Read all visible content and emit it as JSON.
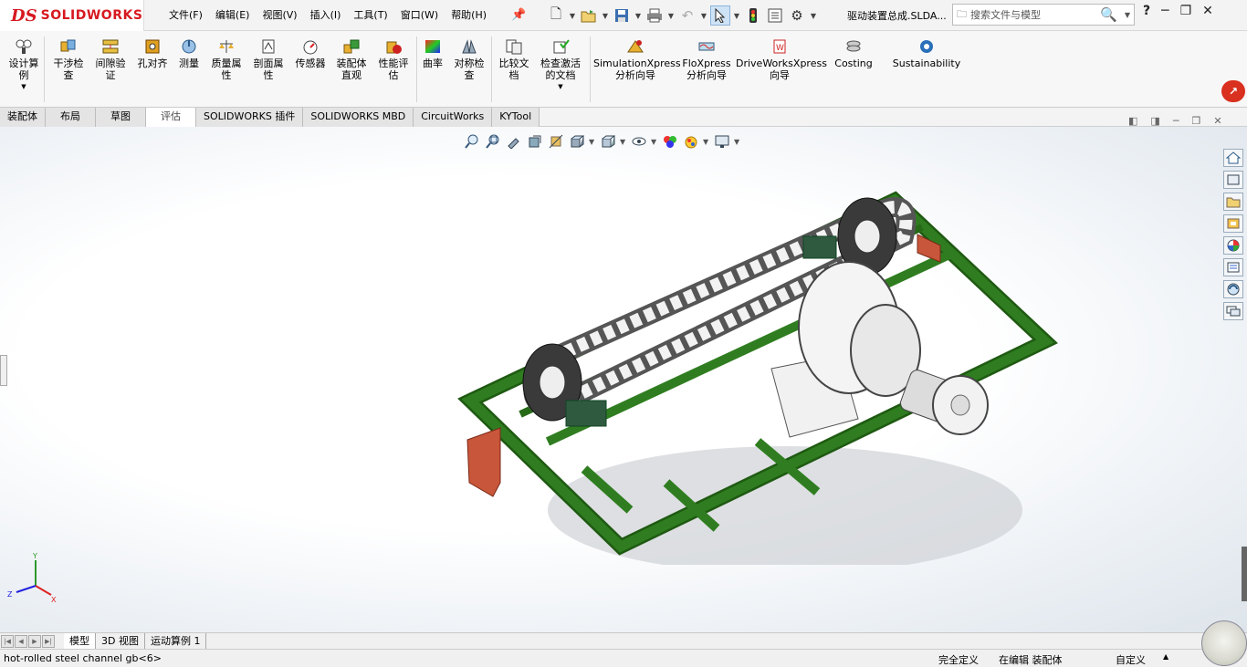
{
  "app": {
    "brand_ds": "DS",
    "brand_name": "SOLIDWORKS"
  },
  "menu": [
    "文件(F)",
    "编辑(E)",
    "视图(V)",
    "插入(I)",
    "工具(T)",
    "窗口(W)",
    "帮助(H)"
  ],
  "document_title": "驱动装置总成.SLDA...",
  "search": {
    "placeholder": "搜索文件与模型"
  },
  "ribbon": {
    "design_study": "设计算例",
    "interference": "干涉检查",
    "clearance": "间隙验证",
    "hole_align": "孔对齐",
    "measure": "测量",
    "mass_props": "质量属性",
    "section_props": "剖面属性",
    "sensor": "传感器",
    "asm_visual": "装配体直观",
    "perf_eval": "性能评估",
    "curvature": "曲率",
    "symmetry": "对称检查",
    "compare": "比较文档",
    "check_active": "检查激活的文档",
    "simxpress": "SimulationXpress分析向导",
    "floxpress": "FloXpress分析向导",
    "driveworks": "DriveWorksXpress向导",
    "costing": "Costing",
    "sustainability": "Sustainability"
  },
  "tabs": [
    "装配体",
    "布局",
    "草图",
    "评估",
    "SOLIDWORKS 插件",
    "SOLIDWORKS MBD",
    "CircuitWorks",
    "KYTool"
  ],
  "active_tab": "评估",
  "model_tabs": [
    "模型",
    "3D 视图",
    "运动算例 1"
  ],
  "status": {
    "left": "hot-rolled steel channel gb<6>",
    "definition": "完全定义",
    "editing": "在编辑 装配体",
    "units": "自定义"
  },
  "triad": {
    "y": "Y",
    "z": "Z",
    "x": "X"
  },
  "colors": {
    "frame": "#2f7d20",
    "accent": "#d71920",
    "bracket": "#c8563a"
  },
  "icons": {
    "design_study": "design-study-icon",
    "interference": "interference-icon",
    "measure": "measure-icon",
    "search": "search-icon",
    "help": "help-icon"
  }
}
